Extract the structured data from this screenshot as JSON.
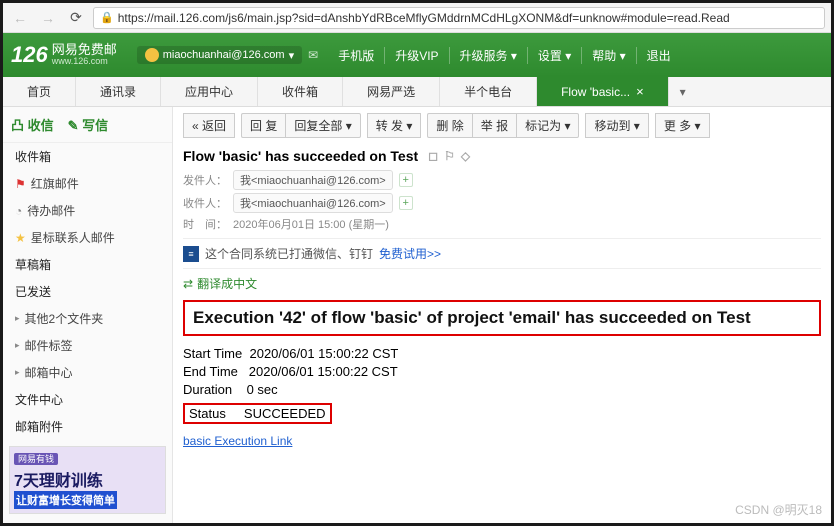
{
  "browser": {
    "url": "https://mail.126.com/js6/main.jsp?sid=dAnshbYdRBceMflyGMddrnMCdHLgXONM&df=unknow#module=read.Read"
  },
  "header": {
    "logo_num": "126",
    "logo_text": "网易免费邮",
    "logo_sub": "www.126.com",
    "user": "miaochuanhai@126.com",
    "links": [
      "手机版",
      "升级VIP",
      "升级服务 ▾",
      "设置 ▾",
      "帮助 ▾",
      "退出"
    ]
  },
  "tabs": {
    "items": [
      "首页",
      "通讯录",
      "应用中心",
      "收件箱",
      "网易严选",
      "半个电台"
    ],
    "active": "Flow 'basic..."
  },
  "sidebar": {
    "receive": "凸 收信",
    "compose": "✎ 写信",
    "items": [
      {
        "label": "收件箱",
        "icon": ""
      },
      {
        "label": "红旗邮件",
        "icon": "flag"
      },
      {
        "label": "待办邮件",
        "icon": "clock"
      },
      {
        "label": "星标联系人邮件",
        "icon": "star"
      },
      {
        "label": "草稿箱",
        "icon": ""
      },
      {
        "label": "已发送",
        "icon": ""
      },
      {
        "label": "其他2个文件夹",
        "icon": "caret"
      },
      {
        "label": "邮件标签",
        "icon": "caret"
      },
      {
        "label": "邮箱中心",
        "icon": "caret"
      },
      {
        "label": "文件中心",
        "icon": ""
      },
      {
        "label": "邮箱附件",
        "icon": ""
      }
    ],
    "ad_tag": "网易有钱",
    "ad_h": "7天理财训练",
    "ad_sub": "让财富增长变得简单"
  },
  "toolbar": {
    "back": "« 返回",
    "reply": "回 复",
    "reply_all": "回复全部 ▾",
    "forward": "转 发 ▾",
    "delete": "删 除",
    "spam": "举 报",
    "mark": "标记为 ▾",
    "move": "移动到 ▾",
    "more": "更 多 ▾"
  },
  "mail": {
    "subject": "Flow 'basic' has succeeded on Test",
    "from_label": "发件人：",
    "from_value": "我<miaochuanhai@126.com>",
    "to_label": "收件人：",
    "to_value": "我<miaochuanhai@126.com>",
    "time_label": "时　间：",
    "time_value": "2020年06月01日 15:00 (星期一)",
    "notice_text": "这个合同系统已打通微信、钉钉",
    "notice_link": "免费试用>>",
    "translate": "翻译成中文"
  },
  "body": {
    "headline": "Execution '42' of flow 'basic' of project 'email' has succeeded on Test",
    "start_label": "Start Time",
    "start_value": "2020/06/01 15:00:22 CST",
    "end_label": "End Time",
    "end_value": "2020/06/01 15:00:22 CST",
    "dur_label": "Duration",
    "dur_value": "0 sec",
    "status_label": "Status",
    "status_value": "SUCCEEDED",
    "link": "basic Execution Link"
  },
  "watermark": "CSDN @明灭18"
}
